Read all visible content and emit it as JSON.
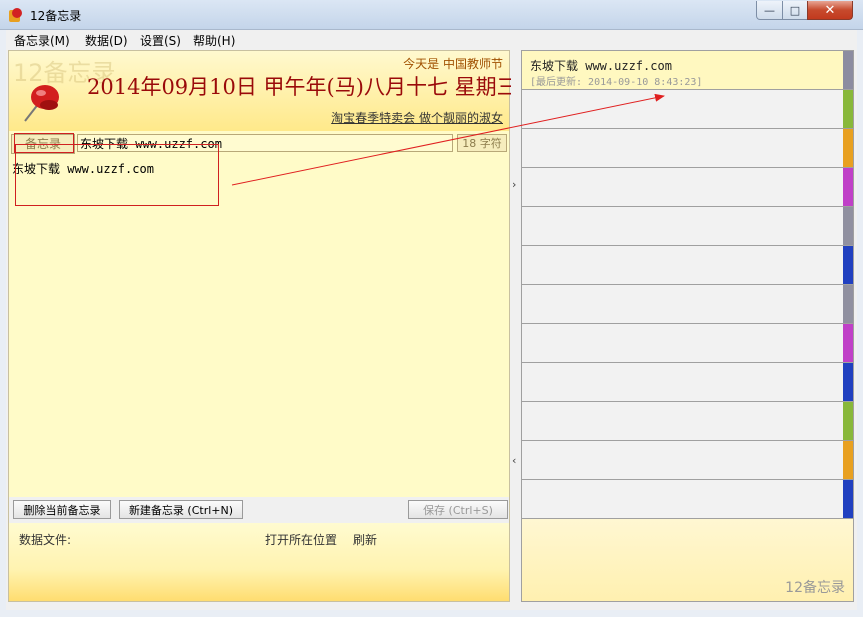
{
  "window": {
    "title": "12备忘录",
    "minimize": "—",
    "maximize": "□",
    "close": "✕"
  },
  "menu": [
    "备忘录(M)",
    "数据(D)",
    "设置(S)",
    "帮助(H)"
  ],
  "header": {
    "watermark": "12备忘录",
    "today": "今天是  中国教师节",
    "date": "2014年09月10日 甲午年(马)八月十七 星期三",
    "promo": "淘宝春季特卖会 做个靓丽的淑女"
  },
  "editor": {
    "label": "备忘录",
    "title_value": "东坡下载 www.uzzf.com",
    "char_count": "18 字符",
    "content": "东坡下载 www.uzzf.com"
  },
  "buttons": {
    "delete": "删除当前备忘录",
    "new": "新建备忘录 (Ctrl+N)",
    "save": "保存 (Ctrl+S)"
  },
  "status": {
    "data_file": "数据文件:",
    "open_location": "打开所在位置",
    "refresh": "刷新"
  },
  "splitter": {
    "expand": "›",
    "collapse": "‹"
  },
  "list": {
    "items": [
      {
        "title": "东坡下载 www.uzzf.com",
        "updated": "[最后更新: 2014-09-10 8:43:23]",
        "color": "#8c8ca0"
      },
      {
        "title": "",
        "updated": "",
        "color": "#88b83a"
      },
      {
        "title": "",
        "updated": "",
        "color": "#e8a020"
      },
      {
        "title": "",
        "updated": "",
        "color": "#c040c8"
      },
      {
        "title": "",
        "updated": "",
        "color": "#9090a0"
      },
      {
        "title": "",
        "updated": "",
        "color": "#2040c0"
      },
      {
        "title": "",
        "updated": "",
        "color": "#9090a0"
      },
      {
        "title": "",
        "updated": "",
        "color": "#c040c8"
      },
      {
        "title": "",
        "updated": "",
        "color": "#2040c0"
      },
      {
        "title": "",
        "updated": "",
        "color": "#88b83a"
      },
      {
        "title": "",
        "updated": "",
        "color": "#e8a020"
      },
      {
        "title": "",
        "updated": "",
        "color": "#2040c0"
      }
    ],
    "brand": "12备忘录"
  }
}
